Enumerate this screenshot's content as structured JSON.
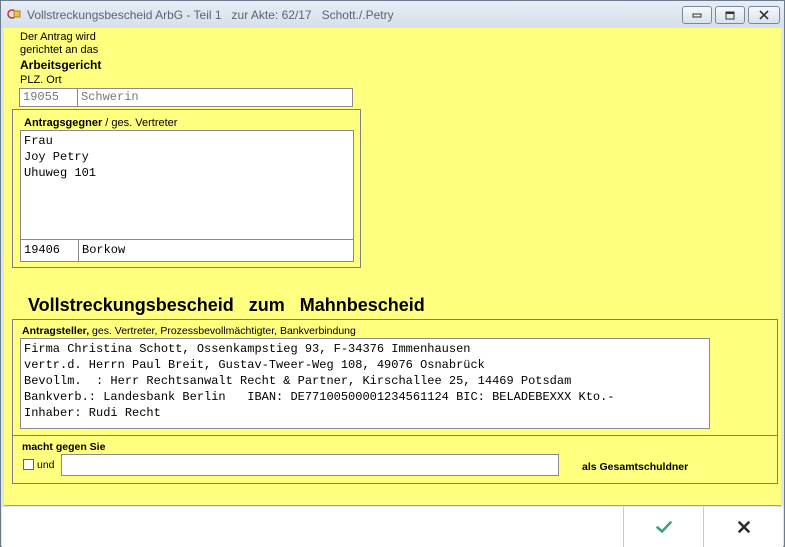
{
  "window": {
    "title": "Vollstreckungsbescheid ArbG - Teil 1   zur Akte: 62/17   Schott./.Petry",
    "minimize_icon": "minimize-icon",
    "maximize_icon": "maximize-icon",
    "close_icon": "close-icon"
  },
  "court": {
    "intro_line1": "Der Antrag wird",
    "intro_line2": "gerichtet an das",
    "court_type": "Arbeitsgericht",
    "plz_ort_label": "PLZ. Ort",
    "plz": "19055",
    "ort": "Schwerin"
  },
  "opponent": {
    "label_bold": "Antragsgegner",
    "label_rest": " / ges. Vertreter",
    "lines": [
      "Frau",
      "Joy Petry",
      "Uhuweg 101",
      "",
      "",
      "",
      ""
    ],
    "plz": "19406",
    "ort": "Borkow"
  },
  "heading": "Vollstreckungsbescheid   zum   Mahnbescheid",
  "applicant": {
    "label_bold": "Antragsteller,",
    "label_rest": " ges. Vertreter, Prozessbevollmächtigter, Bankverbindung",
    "lines": [
      "Firma Christina Schott, Ossenkampstieg 93, F-34376 Immenhausen",
      "vertr.d. Herrn Paul Breit, Gustav-Tweer-Weg 108, 49076 Osnabrück",
      "Bevollm.  : Herr Rechtsanwalt Recht & Partner, Kirschallee 25, 14469 Potsdam",
      "Bankverb.: Landesbank Berlin   IBAN: DE77100500001234561124 BIC: BELADEBEXXX Kto.-",
      "Inhaber: Rudi Recht"
    ]
  },
  "claim": {
    "label": "macht gegen Sie",
    "und_label": "und",
    "und_checked": false,
    "input_value": "",
    "suffix": "als Gesamtschuldner"
  },
  "footer": {
    "ok_icon": "check-icon",
    "cancel_icon": "close-x-icon",
    "ok_color": "#3aa57a"
  }
}
